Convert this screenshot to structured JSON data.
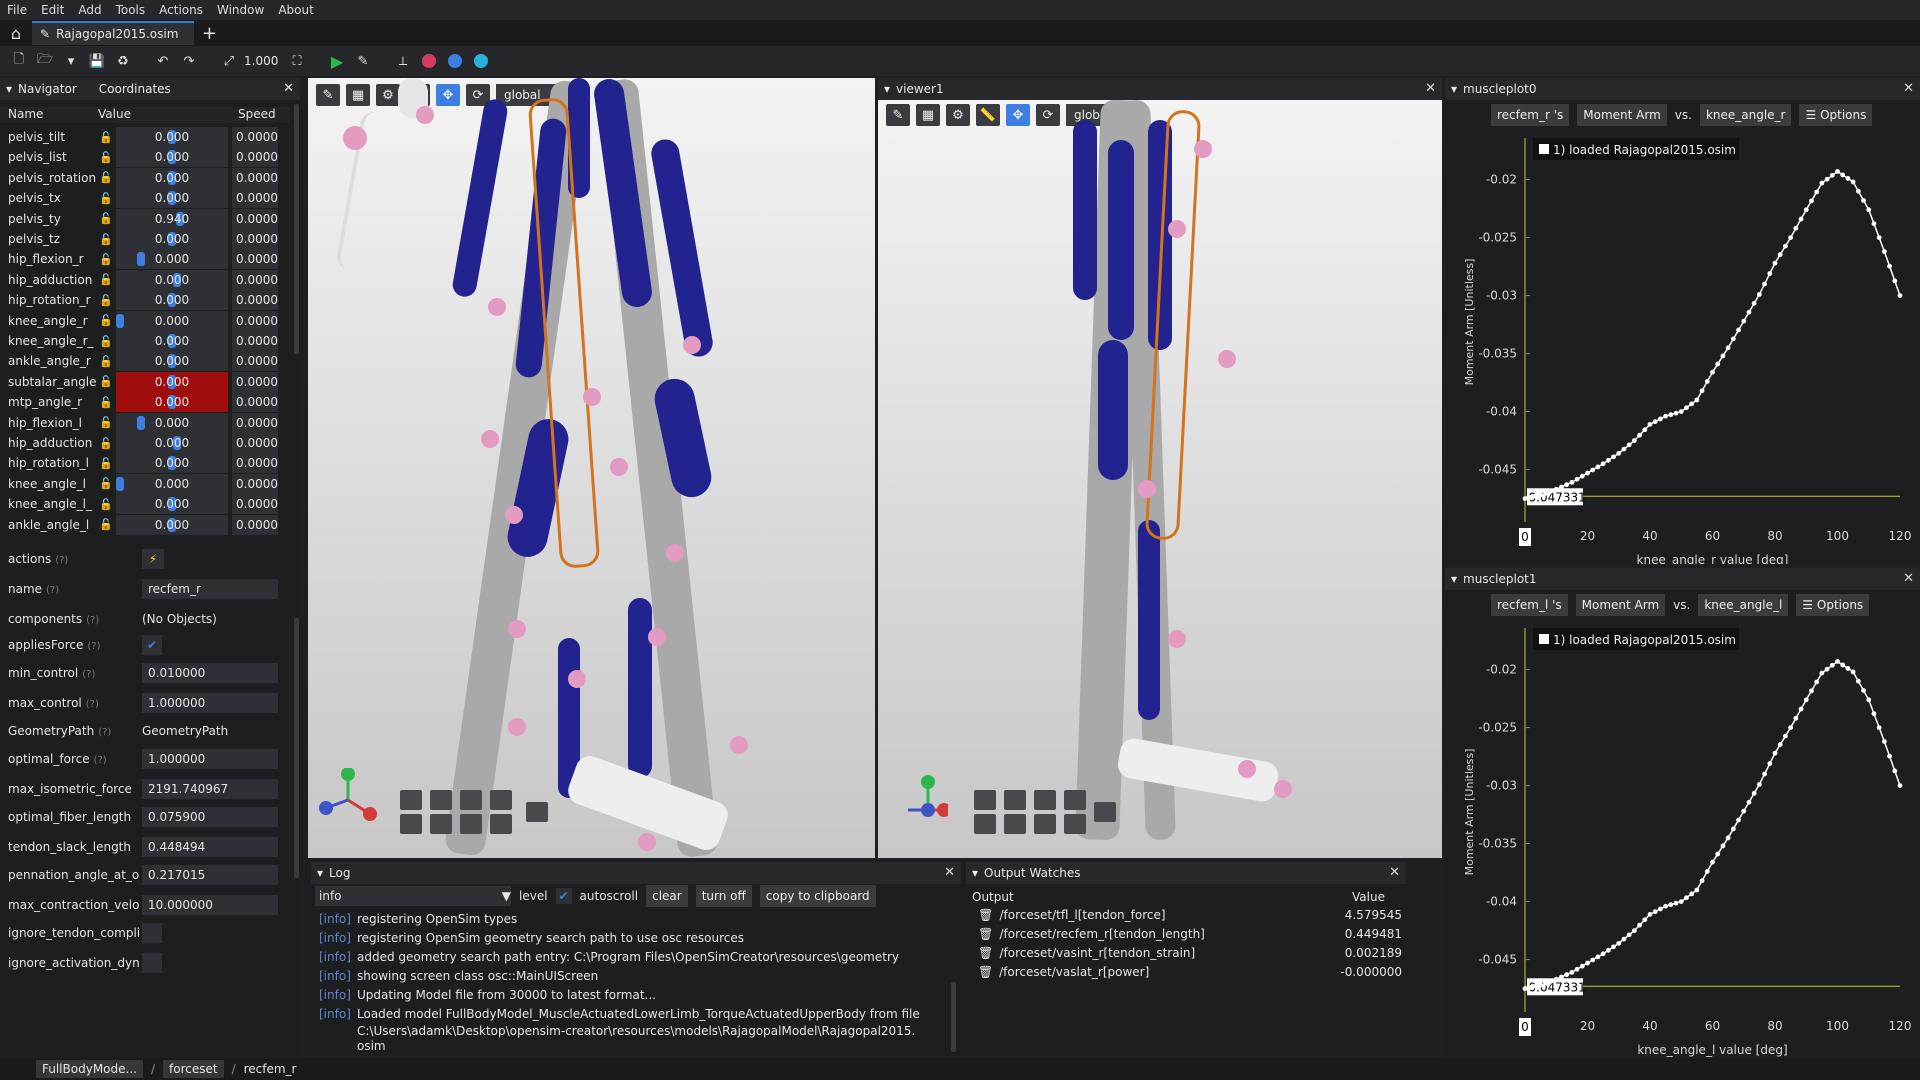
{
  "menu": [
    "File",
    "Edit",
    "Add",
    "Tools",
    "Actions",
    "Window",
    "About"
  ],
  "tab": {
    "file": "Rajagopal2015.osim"
  },
  "toolbar": {
    "zoom": "1.000"
  },
  "navigator": {
    "tab1": "Navigator",
    "tab2": "Coordinates",
    "headers": [
      "Name",
      "Value",
      "Speed"
    ],
    "rows": [
      {
        "name": "pelvis_tilt",
        "value": "0.000",
        "speed": "0.0000",
        "fill": 0.5,
        "red": false
      },
      {
        "name": "pelvis_list",
        "value": "0.000",
        "speed": "0.0000",
        "fill": 0.5,
        "red": false
      },
      {
        "name": "pelvis_rotation",
        "value": "0.000",
        "speed": "0.0000",
        "fill": 0.5,
        "red": false
      },
      {
        "name": "pelvis_tx",
        "value": "0.000",
        "speed": "0.0000",
        "fill": 0.5,
        "red": false
      },
      {
        "name": "pelvis_ty",
        "value": "0.940",
        "speed": "0.0000",
        "fill": 0.58,
        "red": false
      },
      {
        "name": "pelvis_tz",
        "value": "0.000",
        "speed": "0.0000",
        "fill": 0.5,
        "red": false
      },
      {
        "name": "hip_flexion_r",
        "value": "0.000",
        "speed": "0.0000",
        "fill": 0.2,
        "red": false
      },
      {
        "name": "hip_adduction",
        "value": "0.000",
        "speed": "0.0000",
        "fill": 0.55,
        "red": false
      },
      {
        "name": "hip_rotation_r",
        "value": "0.000",
        "speed": "0.0000",
        "fill": 0.5,
        "red": false
      },
      {
        "name": "knee_angle_r",
        "value": "0.000",
        "speed": "0.0000",
        "fill": 0.0,
        "red": false
      },
      {
        "name": "knee_angle_r_",
        "value": "0.000",
        "speed": "0.0000",
        "fill": 0.5,
        "red": false
      },
      {
        "name": "ankle_angle_r",
        "value": "0.000",
        "speed": "0.0000",
        "fill": 0.5,
        "red": false
      },
      {
        "name": "subtalar_angle",
        "value": "0.000",
        "speed": "0.0000",
        "fill": 0.5,
        "red": true
      },
      {
        "name": "mtp_angle_r",
        "value": "0.000",
        "speed": "0.0000",
        "fill": 0.5,
        "red": true
      },
      {
        "name": "hip_flexion_l",
        "value": "0.000",
        "speed": "0.0000",
        "fill": 0.2,
        "red": false
      },
      {
        "name": "hip_adduction",
        "value": "0.000",
        "speed": "0.0000",
        "fill": 0.55,
        "red": false
      },
      {
        "name": "hip_rotation_l",
        "value": "0.000",
        "speed": "0.0000",
        "fill": 0.5,
        "red": false
      },
      {
        "name": "knee_angle_l",
        "value": "0.000",
        "speed": "0.0000",
        "fill": 0.0,
        "red": false
      },
      {
        "name": "knee_angle_l_",
        "value": "0.000",
        "speed": "0.0000",
        "fill": 0.5,
        "red": false
      },
      {
        "name": "ankle_angle_l",
        "value": "0.000",
        "speed": "0.0000",
        "fill": 0.5,
        "red": false
      }
    ]
  },
  "props": [
    {
      "name": "actions",
      "q": "(?)",
      "value": "",
      "kind": "icon"
    },
    {
      "name": "name",
      "q": "(?)",
      "value": "recfem_r",
      "kind": "field"
    },
    {
      "name": "components",
      "q": "(?)",
      "value": "(No Objects)",
      "kind": "text"
    },
    {
      "name": "appliesForce",
      "q": "(?)",
      "value": "",
      "kind": "check"
    },
    {
      "name": "min_control",
      "q": "(?)",
      "value": "0.010000",
      "kind": "field"
    },
    {
      "name": "max_control",
      "q": "(?)",
      "value": "1.000000",
      "kind": "field"
    },
    {
      "name": "GeometryPath",
      "q": "(?)",
      "value": "GeometryPath",
      "kind": "text"
    },
    {
      "name": "optimal_force",
      "q": "(?)",
      "value": "1.000000",
      "kind": "field"
    },
    {
      "name": "max_isometric_force",
      "q": "",
      "value": "2191.740967",
      "kind": "field"
    },
    {
      "name": "optimal_fiber_length",
      "q": "",
      "value": "0.075900",
      "kind": "field"
    },
    {
      "name": "tendon_slack_length",
      "q": "",
      "value": "0.448494",
      "kind": "field"
    },
    {
      "name": "pennation_angle_at_o",
      "q": "",
      "value": "0.217015",
      "kind": "field"
    },
    {
      "name": "max_contraction_velo",
      "q": "",
      "value": "10.000000",
      "kind": "field"
    },
    {
      "name": "ignore_tendon_compli",
      "q": "",
      "value": "",
      "kind": "box"
    },
    {
      "name": "ignore_activation_dyn",
      "q": "",
      "value": "",
      "kind": "box"
    }
  ],
  "viewer0": {
    "frame": "global"
  },
  "viewer1": {
    "title": "viewer1",
    "frame": "global"
  },
  "log": {
    "title": "Log",
    "level_value": "info",
    "level": "level",
    "autoscroll": "autoscroll",
    "clear": "clear",
    "turn_off": "turn off",
    "copy": "copy to clipboard",
    "lines": [
      {
        "tag": "[info]",
        "text": "registering OpenSim types"
      },
      {
        "tag": "[info]",
        "text": "registering OpenSim geometry search path to use osc resources"
      },
      {
        "tag": "[info]",
        "text": "added geometry search path entry: C:\\Program Files\\OpenSimCreator\\resources\\geometry"
      },
      {
        "tag": "[info]",
        "text": "showing screen class osc::MainUIScreen"
      },
      {
        "tag": "[info]",
        "text": "Updating Model file from 30000 to latest format..."
      },
      {
        "tag": "[info]",
        "text": "Loaded model FullBodyModel_MuscleActuatedLowerLimb_TorqueActuatedUpperBody from file"
      },
      {
        "tag": "",
        "text": "C:\\Users\\adamk\\Desktop\\opensim-creator\\resources\\models\\RajagopalModel\\Rajagopal2015."
      },
      {
        "tag": "",
        "text": "osim"
      }
    ]
  },
  "watches": {
    "title": "Output Watches",
    "col1": "Output",
    "col2": "Value",
    "rows": [
      {
        "output": "/forceset/tfl_l[tendon_force]",
        "value": "4.579545"
      },
      {
        "output": "/forceset/recfem_r[tendon_length]",
        "value": "0.449481"
      },
      {
        "output": "/forceset/vasint_r[tendon_strain]",
        "value": "0.002189"
      },
      {
        "output": "/forceset/vaslat_r[power]",
        "value": "-0.000000"
      }
    ]
  },
  "plots": [
    {
      "title": "muscleplot0",
      "muscle": "recfem_r 's",
      "quantity": "Moment Arm",
      "vs": "vs.",
      "coord": "knee_angle_r",
      "options": "Options",
      "legend": "1) loaded Rajagopal2015.osim",
      "marker": "-0.047331",
      "xzero": "0",
      "xlabel": "knee_angle_r value [deg]",
      "ylabel": "Moment Arm [Unitless]"
    },
    {
      "title": "muscleplot1",
      "muscle": "recfem_l 's",
      "quantity": "Moment Arm",
      "vs": "vs.",
      "coord": "knee_angle_l",
      "options": "Options",
      "legend": "1) loaded Rajagopal2015.osim",
      "marker": "-0.047331",
      "xzero": "0",
      "xlabel": "knee_angle_l value [deg]",
      "ylabel": "Moment Arm [Unitless]"
    }
  ],
  "chart_data": [
    {
      "type": "scatter",
      "title": "muscleplot0",
      "xlabel": "knee_angle_r value [deg]",
      "ylabel": "Moment Arm [Unitless]",
      "xlim": [
        0,
        120
      ],
      "ylim": [
        -0.049,
        -0.019
      ],
      "xticks": [
        "20",
        "40",
        "60",
        "80",
        "100",
        "120"
      ],
      "yticks": [
        "-0.02",
        "-0.025",
        "-0.03",
        "-0.035",
        "-0.04",
        "-0.045"
      ],
      "x": [
        0,
        5,
        10,
        15,
        20,
        25,
        30,
        35,
        40,
        45,
        50,
        55,
        60,
        65,
        70,
        75,
        80,
        85,
        90,
        95,
        100,
        105,
        110,
        115,
        120
      ],
      "y": [
        -0.0475,
        -0.0472,
        -0.0467,
        -0.0461,
        -0.0453,
        -0.0445,
        -0.0436,
        -0.0425,
        -0.0411,
        -0.0404,
        -0.04,
        -0.039,
        -0.0366,
        -0.0345,
        -0.0322,
        -0.0299,
        -0.0272,
        -0.025,
        -0.0226,
        -0.0203,
        -0.0193,
        -0.0202,
        -0.0226,
        -0.0262,
        -0.03
      ],
      "series": [
        {
          "name": "1) loaded Rajagopal2015.osim"
        }
      ]
    },
    {
      "type": "scatter",
      "title": "muscleplot1",
      "xlabel": "knee_angle_l value [deg]",
      "ylabel": "Moment Arm [Unitless]",
      "xlim": [
        0,
        120
      ],
      "ylim": [
        -0.049,
        -0.019
      ],
      "xticks": [
        "20",
        "40",
        "60",
        "80",
        "100",
        "120"
      ],
      "yticks": [
        "-0.02",
        "-0.025",
        "-0.03",
        "-0.035",
        "-0.04",
        "-0.045"
      ],
      "x": [
        0,
        5,
        10,
        15,
        20,
        25,
        30,
        35,
        40,
        45,
        50,
        55,
        60,
        65,
        70,
        75,
        80,
        85,
        90,
        95,
        100,
        105,
        110,
        115,
        120
      ],
      "y": [
        -0.0475,
        -0.0472,
        -0.0467,
        -0.0461,
        -0.0453,
        -0.0445,
        -0.0436,
        -0.0425,
        -0.0411,
        -0.0404,
        -0.04,
        -0.039,
        -0.0366,
        -0.0345,
        -0.0322,
        -0.0299,
        -0.0272,
        -0.025,
        -0.0226,
        -0.0203,
        -0.0193,
        -0.0202,
        -0.0226,
        -0.0262,
        -0.03
      ],
      "series": [
        {
          "name": "1) loaded Rajagopal2015.osim"
        }
      ]
    }
  ],
  "breadcrumbs": [
    "FullBodyMode...",
    "forceset",
    "recfem_r"
  ],
  "colors": {
    "accent": "#3d7ee0",
    "muscle": "#23238f",
    "locked_red": "#a00d0d",
    "highlight": "#d3731b"
  }
}
